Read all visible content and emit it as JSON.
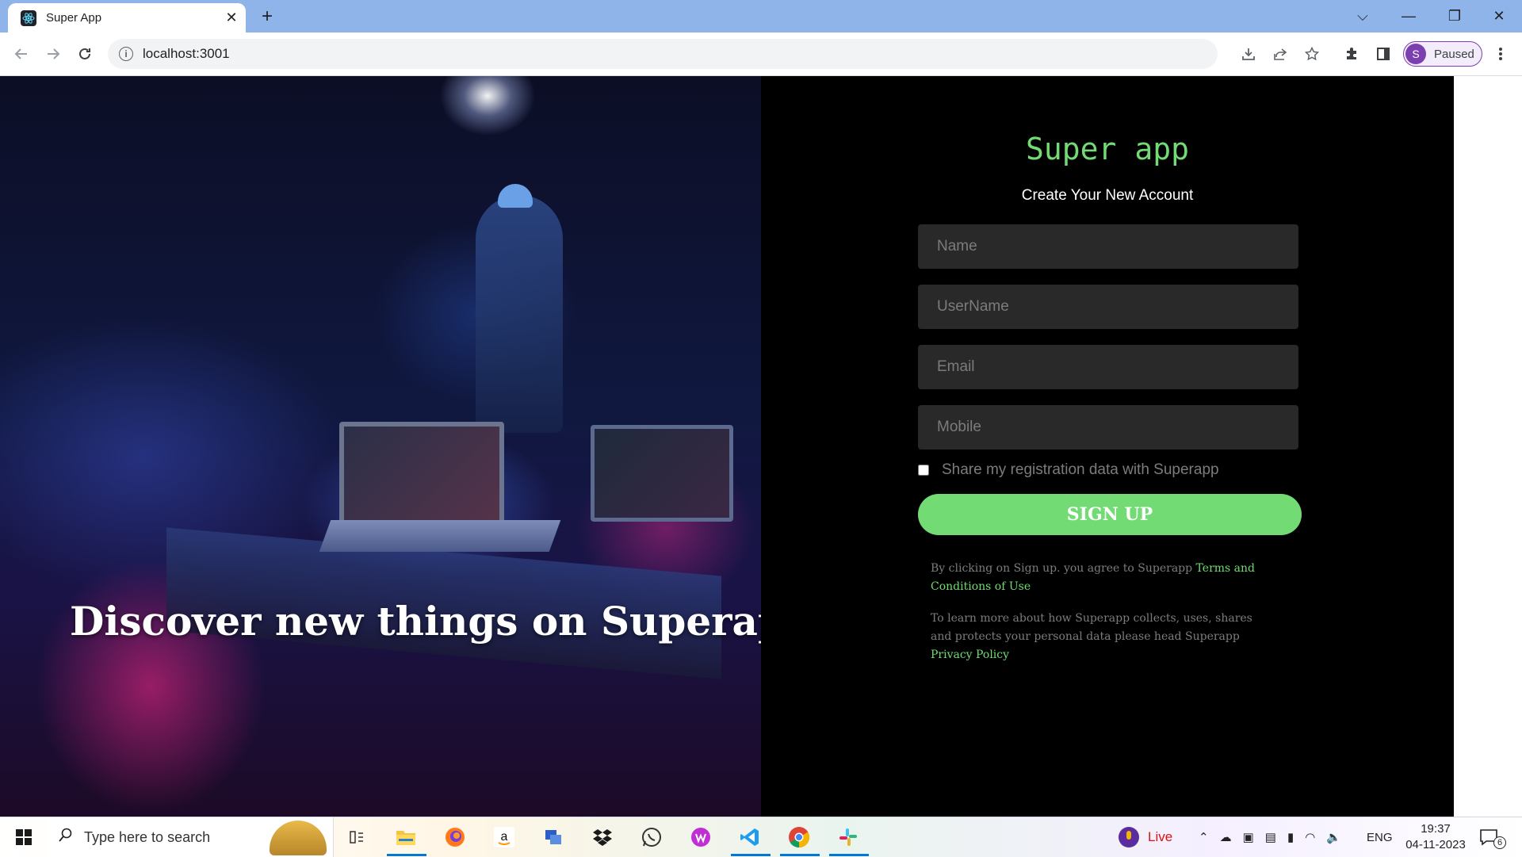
{
  "browser": {
    "tab_title": "Super App",
    "tab_close": "✕",
    "new_tab": "+",
    "url": "localhost:3001",
    "profile_initial": "S",
    "profile_status": "Paused",
    "window_controls": {
      "dropdown": "⌵",
      "minimize": "—",
      "restore": "❐",
      "close": "✕"
    }
  },
  "hero": {
    "caption": "Discover new things on Superapp"
  },
  "form": {
    "brand": "Super app",
    "subtitle": "Create Your New Account",
    "name_placeholder": "Name",
    "username_placeholder": "UserName",
    "email_placeholder": "Email",
    "mobile_placeholder": "Mobile",
    "share_label": "Share my registration data with Superapp",
    "share_checked": false,
    "signup_label": "SIGN UP",
    "legal1_text": "By clicking on Sign up. you agree to Superapp ",
    "legal1_link": "Terms and Conditions of Use",
    "legal2_text": "To learn more about how Superapp collects, uses, shares and protects your personal data please head Superapp ",
    "legal2_link": "Privacy Policy"
  },
  "colors": {
    "accent_green": "#72db73",
    "field_bg": "#292929",
    "placeholder": "#7c7c7c"
  },
  "taskbar": {
    "search_placeholder": "Type here to search",
    "live_label": "Live",
    "language": "ENG",
    "time": "19:37",
    "date": "04-11-2023",
    "notification_count": "6",
    "apps": [
      "task-view-icon",
      "file-explorer-icon",
      "firefox-icon",
      "amazon-icon",
      "network-app-icon",
      "dropbox-icon",
      "whatsapp-icon",
      "wps-office-icon",
      "vscode-icon",
      "chrome-icon",
      "slack-icon"
    ]
  }
}
